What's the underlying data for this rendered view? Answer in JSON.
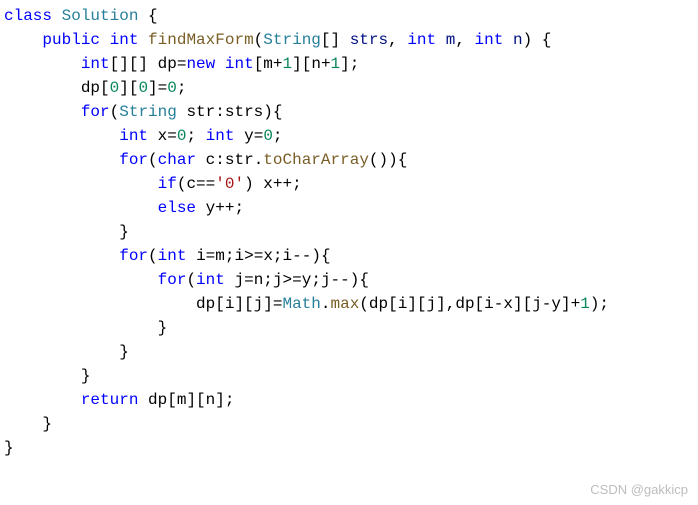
{
  "code": {
    "line1": {
      "kw_class": "class",
      "cls": "Solution",
      "brace": " {"
    },
    "line2": {
      "indent": "    ",
      "kw_public": "public",
      "sp1": " ",
      "kw_int": "int",
      "sp2": " ",
      "fn": "findMaxForm",
      "open": "(",
      "cls_string": "String",
      "arr": "[] ",
      "p1": "strs",
      "c1": ", ",
      "kw_int2": "int",
      "sp3": " ",
      "p2": "m",
      "c2": ", ",
      "kw_int3": "int",
      "sp4": " ",
      "p3": "n",
      "close": ") {"
    },
    "line3": {
      "indent": "        ",
      "kw_int": "int",
      "arr": "[][] ",
      "v": "dp",
      "eq": "=",
      "kw_new": "new",
      "sp": " ",
      "kw_int2": "int",
      "o": "[",
      "p1": "m",
      "plus": "+",
      "n1": "1",
      "mid": "][",
      "p2": "n",
      "plus2": "+",
      "n2": "1",
      "close": "];"
    },
    "line4": {
      "indent": "        ",
      "v": "dp",
      "o": "[",
      "n1": "0",
      "m": "][",
      "n2": "0",
      "c": "]=",
      "n3": "0",
      "s": ";"
    },
    "line5": {
      "indent": "        ",
      "kw_for": "for",
      "o": "(",
      "cls": "String",
      "sp": " ",
      "v": "str",
      "col": ":",
      "p": "strs",
      "c": "){"
    },
    "line6": {
      "indent": "            ",
      "kw_int": "int",
      "sp": " ",
      "v1": "x",
      "eq": "=",
      "n1": "0",
      "s1": "; ",
      "kw_int2": "int",
      "sp2": " ",
      "v2": "y",
      "eq2": "=",
      "n2": "0",
      "s2": ";"
    },
    "line7": {
      "indent": "            ",
      "kw_for": "for",
      "o": "(",
      "kw_char": "char",
      "sp": " ",
      "v": "c",
      "col": ":",
      "v2": "str",
      "dot": ".",
      "fn": "toCharArray",
      "c": "()){"
    },
    "line8": {
      "indent": "                ",
      "kw_if": "if",
      "o": "(",
      "v": "c",
      "eq": "==",
      "str": "'0'",
      "c": ") ",
      "v2": "x",
      "inc": "++;"
    },
    "line9": {
      "indent": "                ",
      "kw_else": "else",
      "sp": " ",
      "v": "y",
      "inc": "++;"
    },
    "line10": {
      "indent": "            ",
      "brace": "}"
    },
    "line11": {
      "indent": "            ",
      "kw_for": "for",
      "o": "(",
      "kw_int": "int",
      "sp": " ",
      "v": "i",
      "eq": "=",
      "p": "m",
      "s": ";",
      "v2": "i",
      "op": ">=",
      "v3": "x",
      "s2": ";",
      "v4": "i",
      "dec": "--){"
    },
    "line12": {
      "indent": "                ",
      "kw_for": "for",
      "o": "(",
      "kw_int": "int",
      "sp": " ",
      "v": "j",
      "eq": "=",
      "p": "n",
      "s": ";",
      "v2": "j",
      "op": ">=",
      "v3": "y",
      "s2": ";",
      "v4": "j",
      "dec": "--){"
    },
    "line13": {
      "indent": "                    ",
      "v": "dp",
      "o": "[",
      "v1": "i",
      "m": "][",
      "v2": "j",
      "c": "]=",
      "cls": "Math",
      "dot": ".",
      "fn": "max",
      "op": "(",
      "v3": "dp",
      "o2": "[",
      "v4": "i",
      "m2": "][",
      "v5": "j",
      "c2": "],",
      "v6": "dp",
      "o3": "[",
      "v7": "i",
      "minus": "-",
      "v8": "x",
      "m3": "][",
      "v9": "j",
      "minus2": "-",
      "v10": "y",
      "c3": "]+",
      "n": "1",
      "close": ");"
    },
    "line14": {
      "indent": "                ",
      "brace": "}"
    },
    "line15": {
      "indent": "            ",
      "brace": "}"
    },
    "line16": {
      "indent": "        ",
      "brace": "}"
    },
    "line17": {
      "indent": "        ",
      "kw_return": "return",
      "sp": " ",
      "v": "dp",
      "o": "[",
      "p1": "m",
      "m": "][",
      "p2": "n",
      "c": "];"
    },
    "line18": {
      "indent": "    ",
      "brace": "}"
    },
    "line19": {
      "brace": "}"
    }
  },
  "watermark": "CSDN @gakkicp"
}
